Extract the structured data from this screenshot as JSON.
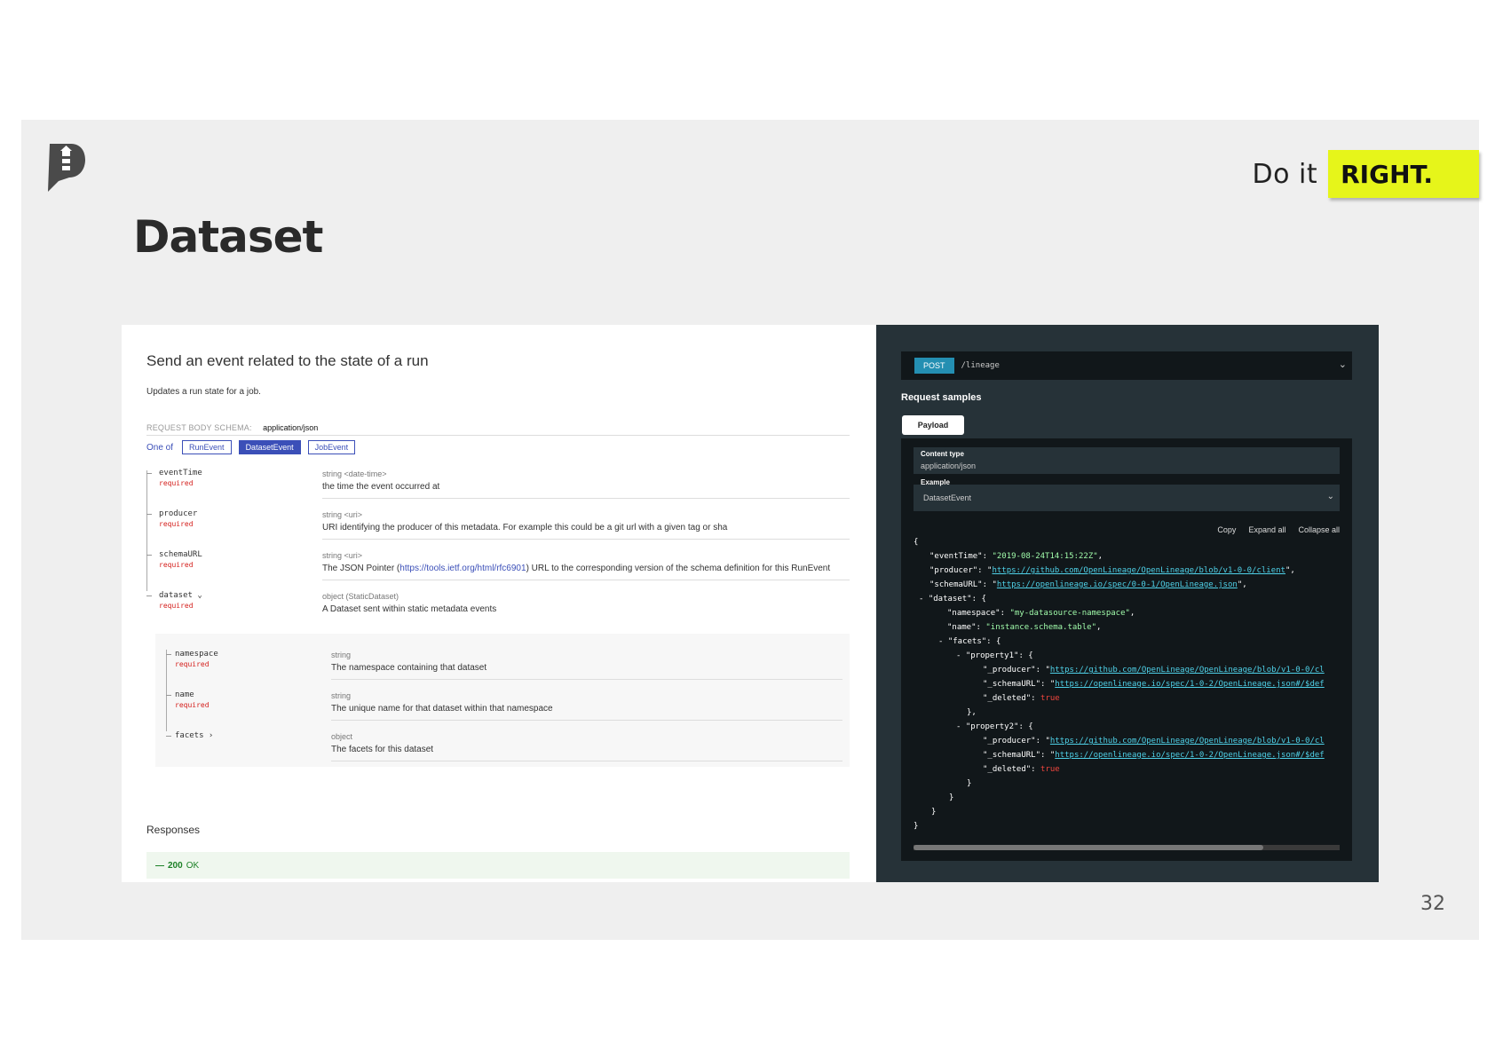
{
  "slide": {
    "tagline_prefix": "Do it",
    "tagline_highlight": "RIGHT.",
    "title": "Dataset",
    "page_number": "32",
    "accent_color": "#e6f51a"
  },
  "left": {
    "endpoint_title": "Send an event related to the state of a run",
    "endpoint_desc": "Updates a run state for a job.",
    "schema_label": "REQUEST BODY SCHEMA:",
    "schema_value": "application/json",
    "oneof_label": "One of",
    "oneof_options": [
      "RunEvent",
      "DatasetEvent",
      "JobEvent"
    ],
    "selected_option": "DatasetEvent",
    "props": [
      {
        "name": "eventTime",
        "required": "required",
        "type": "string <date-time>",
        "desc": "the time the event occurred at"
      },
      {
        "name": "producer",
        "required": "required",
        "type": "string <uri>",
        "desc": "URI identifying the producer of this metadata. For example this could be a git url with a given tag or sha"
      },
      {
        "name": "schemaURL",
        "required": "required",
        "type": "string <uri>",
        "desc_pre": "The JSON Pointer (",
        "desc_link": "https://tools.ietf.org/html/rfc6901",
        "desc_post": ") URL to the corresponding version of the schema definition for this RunEvent"
      },
      {
        "name": "dataset ⌄",
        "required": "required",
        "type": "object (StaticDataset)",
        "desc": "A Dataset sent within static metadata events"
      }
    ],
    "nested": [
      {
        "name": "namespace",
        "required": "required",
        "type": "string",
        "desc": "The namespace containing that dataset"
      },
      {
        "name": "name",
        "required": "required",
        "type": "string",
        "desc": "The unique name for that dataset within that namespace"
      },
      {
        "name": "facets ›",
        "type": "object",
        "desc": "The facets for this dataset"
      }
    ],
    "responses_title": "Responses",
    "response_prefix": "—",
    "response_code": "200",
    "response_text": "OK"
  },
  "right": {
    "method": "POST",
    "path": "/lineage",
    "samples_title": "Request samples",
    "tab": "Payload",
    "content_type_label": "Content type",
    "content_type_value": "application/json",
    "example_label": "Example",
    "example_value": "DatasetEvent",
    "actions": [
      "Copy",
      "Expand all",
      "Collapse all"
    ],
    "code": {
      "open": "{",
      "l1": "\"eventTime\": ",
      "v1": "\"2019-08-24T14:15:22Z\"",
      "l2": "\"producer\": ",
      "v2": "https://github.com/OpenLineage/OpenLineage/blob/v1-0-0/client",
      "l3": "\"schemaURL\": ",
      "v3": "https://openlineage.io/spec/0-0-1/OpenLineage.json",
      "l4": "- \"dataset\": {",
      "l5": "\"namespace\": ",
      "v5": "\"my-datasource-namespace\"",
      "l6": "\"name\": ",
      "v6": "\"instance.schema.table\"",
      "l7": "- \"facets\": {",
      "l8": "- \"property1\": {",
      "l9": "\"_producer\": ",
      "v9": "https://github.com/OpenLineage/OpenLineage/blob/v1-0-0/cl",
      "l10": "\"_schemaURL\": ",
      "v10": "https://openlineage.io/spec/1-0-2/OpenLineage.json#/$def",
      "l11": "\"_deleted\": ",
      "v11": "true",
      "l12": "},",
      "l13": "- \"property2\": {",
      "l14": "\"_producer\": ",
      "v14": "https://github.com/OpenLineage/OpenLineage/blob/v1-0-0/cl",
      "l15": "\"_schemaURL\": ",
      "v15": "https://openlineage.io/spec/1-0-2/OpenLineage.json#/$def",
      "l16": "\"_deleted\": ",
      "v16": "true",
      "close": "}"
    },
    "scroll_fraction": 0.82
  }
}
